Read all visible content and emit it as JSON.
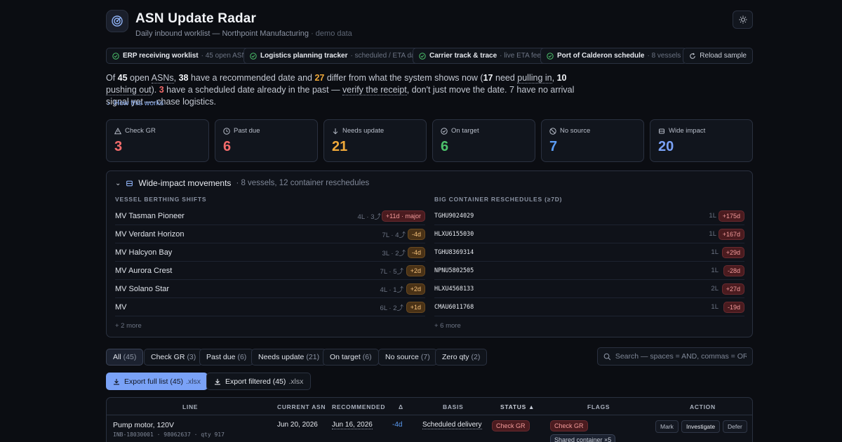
{
  "app": {
    "title": "ASN Update Radar",
    "subtitle": "Daily inbound worklist — Northpoint Manufacturing",
    "subtitle_tag": "· demo data"
  },
  "sources": [
    {
      "name": "ERP receiving worklist",
      "desc": "· 45 open ASNs"
    },
    {
      "name": "Logistics planning tracker",
      "desc": "· scheduled / ETA dates"
    },
    {
      "name": "Carrier track & trace",
      "desc": "· live ETA feed"
    },
    {
      "name": "Port of Calderon schedule",
      "desc": "· 8 vessels"
    }
  ],
  "reload_label": "Reload sample",
  "summary": {
    "p1": "Of ",
    "n_open": "45",
    "p2": " open ",
    "asns": "ASNs",
    "p3": ", ",
    "n_rec": "38",
    "p4": " have a recommended date and ",
    "n_differ": "27",
    "p5": " differ from what the system shows now (",
    "n_pull": "17",
    "p6": " need ",
    "pulling_in": "pulling in",
    "p7": ", ",
    "n_push": "10",
    "p8": " ",
    "pushing_out": "pushing out",
    "p9": "). ",
    "n_past": "3",
    "p10": " have a scheduled date already in the past — ",
    "verify": "verify the receipt",
    "p11": ", don't just move the date. 7 have no arrival signal yet — chase logistics."
  },
  "how_label": "How this works",
  "cards": [
    {
      "label": "Check GR",
      "value": "3",
      "color": "#f26b6b",
      "icon": "warning-icon"
    },
    {
      "label": "Past due",
      "value": "6",
      "color": "#f26b6b",
      "icon": "clock-icon"
    },
    {
      "label": "Needs update",
      "value": "21",
      "color": "#f0a93a",
      "icon": "arrow-down-icon"
    },
    {
      "label": "On target",
      "value": "6",
      "color": "#4cc26b",
      "icon": "check-circle-icon"
    },
    {
      "label": "No source",
      "value": "7",
      "color": "#5b9cf5",
      "icon": "no-source-icon"
    },
    {
      "label": "Wide impact",
      "value": "20",
      "color": "#7aa2f7",
      "icon": "ship-icon"
    }
  ],
  "wide": {
    "title": "Wide-impact movements",
    "sub": "· 8 vessels, 12 container reschedules",
    "vessels_header": "VESSEL BERTHING SHIFTS",
    "containers_header": "BIG CONTAINER RESCHEDULES (≥7D)",
    "vessels": [
      {
        "name": "MV Tasman Pioneer",
        "meta": "4L · 3⤴",
        "delta": "+11d · major",
        "tone": "red"
      },
      {
        "name": "MV Verdant Horizon",
        "meta": "7L · 4⤴",
        "delta": "-4d",
        "tone": "orange"
      },
      {
        "name": "MV Halcyon Bay",
        "meta": "3L · 2⤴",
        "delta": "-4d",
        "tone": "orange"
      },
      {
        "name": "MV Aurora Crest",
        "meta": "7L · 5⤴",
        "delta": "+2d",
        "tone": "orange"
      },
      {
        "name": "MV Solano Star",
        "meta": "4L · 1⤴",
        "delta": "+2d",
        "tone": "orange"
      },
      {
        "name": "MV",
        "meta": "6L · 2⤴",
        "delta": "+1d",
        "tone": "orange"
      }
    ],
    "vessels_more": "+ 2 more",
    "containers": [
      {
        "id": "TGHU9024029",
        "meta": "1L",
        "delta": "+175d"
      },
      {
        "id": "HLXU6155030",
        "meta": "1L",
        "delta": "+167d"
      },
      {
        "id": "TGHU8369314",
        "meta": "1L",
        "delta": "+29d"
      },
      {
        "id": "NPNU5802505",
        "meta": "1L",
        "delta": "-28d"
      },
      {
        "id": "HLXU4568133",
        "meta": "2L",
        "delta": "+27d"
      },
      {
        "id": "CMAU6011768",
        "meta": "1L",
        "delta": "-19d"
      }
    ],
    "containers_more": "+ 6 more"
  },
  "filters": [
    {
      "label": "All",
      "count": "(45)"
    },
    {
      "label": "Check GR",
      "count": "(3)"
    },
    {
      "label": "Past due",
      "count": "(6)"
    },
    {
      "label": "Needs update",
      "count": "(21)"
    },
    {
      "label": "On target",
      "count": "(6)"
    },
    {
      "label": "No source",
      "count": "(7)"
    },
    {
      "label": "Zero qty",
      "count": "(2)"
    }
  ],
  "search_placeholder": "Search — spaces = AND, commas = OR",
  "export_full": {
    "label": "Export full list (45)",
    "ext": ".xlsx"
  },
  "export_filtered": {
    "label": "Export filtered (45)",
    "ext": ".xlsx"
  },
  "table": {
    "headers": {
      "line": "LINE",
      "current": "CURRENT ASN",
      "recommended": "RECOMMENDED",
      "delta": "Δ",
      "basis": "BASIS",
      "status": "STATUS ▲",
      "flags": "FLAGS",
      "action": "ACTION"
    },
    "rows": [
      {
        "line": "Pump motor, 120V",
        "line_sub": "INB-18030001 · 98062637 · qty 917",
        "current": "Jun 20, 2026",
        "recommended": "Jun 16, 2026",
        "delta": "-4d",
        "basis": "Scheduled delivery",
        "status": "Check GR",
        "flag1": "Check GR",
        "flag2": "Shared container ×5",
        "actions": [
          "Mark",
          "Investigate",
          "Defer"
        ]
      }
    ]
  }
}
